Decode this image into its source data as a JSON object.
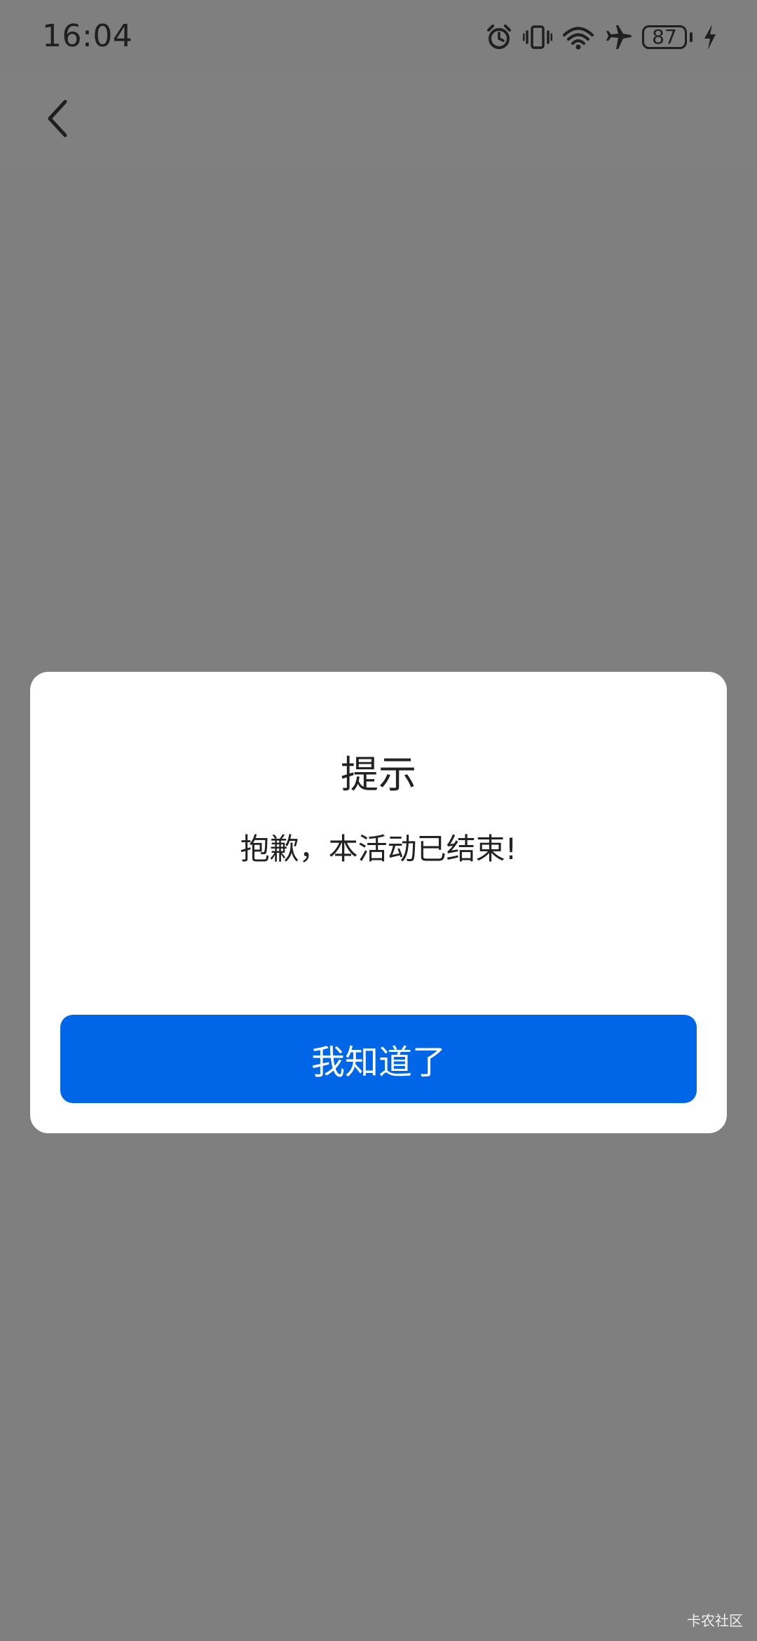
{
  "status_bar": {
    "time": "16:04",
    "battery_level": "87",
    "icons": [
      "alarm-icon",
      "vibrate-icon",
      "wifi-icon",
      "airplane-icon",
      "battery-icon",
      "charging-icon"
    ]
  },
  "nav": {
    "back_icon": "chevron-left-icon"
  },
  "dialog": {
    "title": "提示",
    "message": "抱歉，本活动已结束!",
    "confirm_label": "我知道了"
  },
  "watermark": "卡农社区",
  "colors": {
    "overlay": "#7f7f7f",
    "accent": "#0066e8",
    "dialog_bg": "#ffffff",
    "text": "#222222"
  }
}
